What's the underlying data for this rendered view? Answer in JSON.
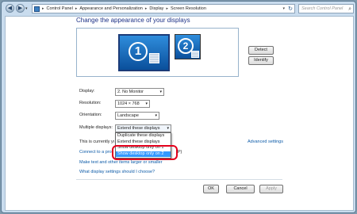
{
  "nav": {
    "back_icon": "back-arrow-icon",
    "forward_icon": "forward-arrow-icon",
    "breadcrumb": [
      "Control Panel",
      "Appearance and Personalization",
      "Display",
      "Screen Resolution"
    ],
    "separator": "▸",
    "search_placeholder": "Search Control Panel"
  },
  "page": {
    "title": "Change the appearance of your displays"
  },
  "monitors": {
    "primary_number": "1",
    "secondary_number": "2"
  },
  "buttons": {
    "detect": "Detect",
    "identify": "Identify",
    "ok": "OK",
    "cancel": "Cancel",
    "apply": "Apply"
  },
  "settings": {
    "display_label": "Display:",
    "display_value": "2. No Monitor",
    "resolution_label": "Resolution:",
    "resolution_value": "1024 × 768",
    "orientation_label": "Orientation:",
    "orientation_value": "Landscape",
    "multiple_label": "Multiple displays:",
    "multiple_value": "Extend these displays"
  },
  "dropdown": {
    "options": [
      "Duplicate these displays",
      "Extend these displays",
      "Show desktop only on 1",
      "Show desktop only on 2"
    ],
    "selected_index": 3
  },
  "status": {
    "text_visible": "This is currently yo",
    "suffix": "(P)"
  },
  "links": {
    "advanced": "Advanced settings",
    "connect": "Connect to a pro",
    "text_size": "Make text and other items larger or smaller",
    "which_settings": "What display settings should I choose?"
  },
  "colors": {
    "accent": "#1e3287",
    "link": "#0d5ba8",
    "selection": "#3399ff",
    "highlight_ring": "#e3001b"
  }
}
